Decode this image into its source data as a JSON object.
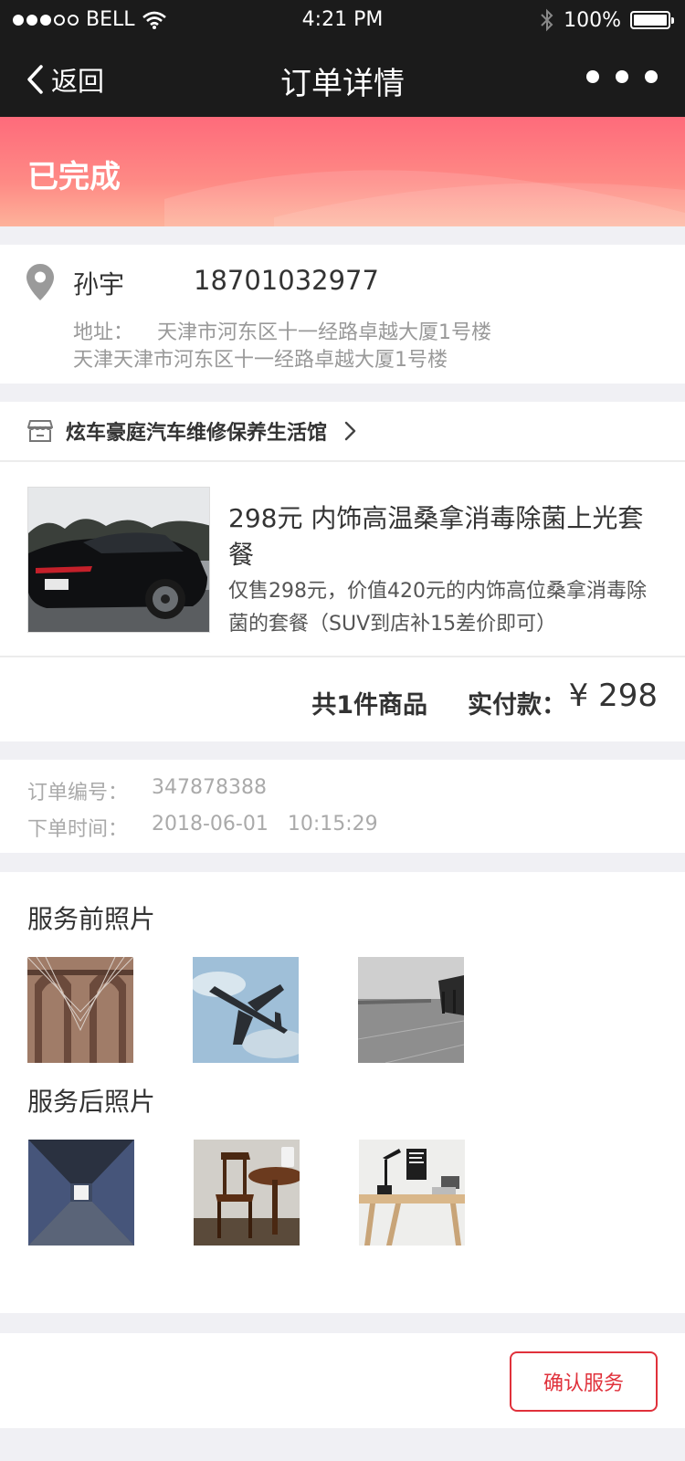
{
  "status_bar": {
    "carrier": "BELL",
    "time": "4:21 PM",
    "battery": "100%",
    "battery_level": 1.0
  },
  "nav": {
    "back_label": "返回",
    "title": "订单详情"
  },
  "order_status": {
    "label": "已完成",
    "colors": {
      "start": "#fe6b7b",
      "end": "#fdb29a"
    }
  },
  "address": {
    "name": "孙宇",
    "phone": "18701032977",
    "label": "地址：",
    "line1": "天津市河东区十一经路卓越大厦1号楼",
    "line2": "天津天津市河东区十一经路卓越大厦1号楼"
  },
  "shop": {
    "name": "炫车豪庭汽车维修保养生活馆"
  },
  "product": {
    "title": "298元 内饰高温桑拿消毒除菌上光套餐",
    "description": "仅售298元，价值420元的内饰高位桑拿消毒除菌的套餐（SUV到店补15差价即可）",
    "image": "car-photo"
  },
  "totals": {
    "count_text": "共1件商品",
    "paid_label": "实付款：",
    "amount": "¥ 298"
  },
  "order_info": {
    "number_label": "订单编号：",
    "number": "347878388",
    "time_label": "下单时间：",
    "time": "2018-06-01   10:15:29"
  },
  "photos": {
    "before_title": "服务前照片",
    "after_title": "服务后照片",
    "before_images": [
      "bridge-photo",
      "airplane-photo",
      "pier-photo"
    ],
    "after_images": [
      "corridor-photo",
      "chair-table-photo",
      "desk-photo"
    ]
  },
  "footer": {
    "confirm_label": "确认服务",
    "accent_color": "#e0313b"
  }
}
